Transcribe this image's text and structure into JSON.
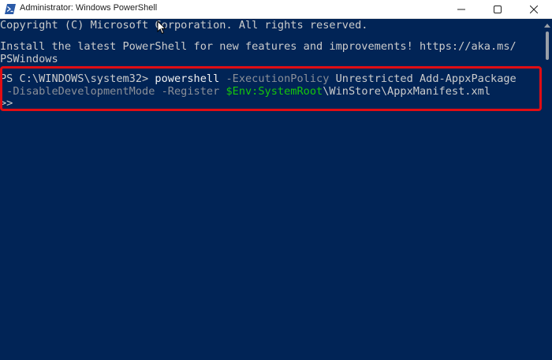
{
  "window": {
    "title": "Administrator: Windows PowerShell",
    "icons": {
      "app": "powershell-icon",
      "minimize": "minimize-icon",
      "maximize": "maximize-icon",
      "close": "close-icon",
      "cursor": "mouse-pointer-icon"
    }
  },
  "terminal": {
    "copyright": "Copyright (C) Microsoft Corporation. All rights reserved.",
    "install_line1": "Install the latest PowerShell for new features and improvements! https://aka.ms/",
    "install_line2": "PSWindows",
    "prompt": "PS C:\\WINDOWS\\system32> ",
    "command": "powershell",
    "param1": " -ExecutionPolicy",
    "arg1": " Unrestricted Add-AppxPackage",
    "param2": " -DisableDevelopmentMode -Register",
    "var": " $Env:SystemRoot",
    "path": "\\WinStore\\AppxManifest.xml",
    "continuation": ">>"
  },
  "colors": {
    "background": "#012456",
    "text": "#cccccc",
    "parameter": "#8a8f98",
    "variable": "#16c60c",
    "highlight": "#e10d13"
  }
}
